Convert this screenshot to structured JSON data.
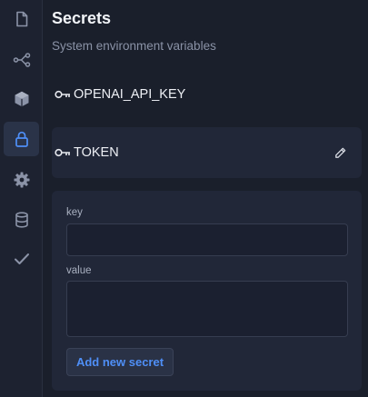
{
  "sidebar": {
    "items": [
      {
        "icon": "file-icon",
        "active": false
      },
      {
        "icon": "share-nodes-icon",
        "active": false
      },
      {
        "icon": "cube-icon",
        "active": false
      },
      {
        "icon": "lock-icon",
        "active": true
      },
      {
        "icon": "gear-icon",
        "active": false
      },
      {
        "icon": "database-icon",
        "active": false
      },
      {
        "icon": "checkmark-icon",
        "active": false
      }
    ]
  },
  "header": {
    "title": "Secrets",
    "subtitle": "System environment variables"
  },
  "secrets": [
    {
      "name": "OPENAI_API_KEY"
    },
    {
      "name": "TOKEN"
    }
  ],
  "form": {
    "key_label": "key",
    "value_label": "value",
    "key_value": "",
    "value_value": "",
    "add_button_label": "Add new secret"
  },
  "colors": {
    "background": "#1a1f2b",
    "panel": "#212738",
    "accent": "#4f8ff7",
    "icon": "#8b93a7",
    "active_icon": "#4f8ff7"
  }
}
